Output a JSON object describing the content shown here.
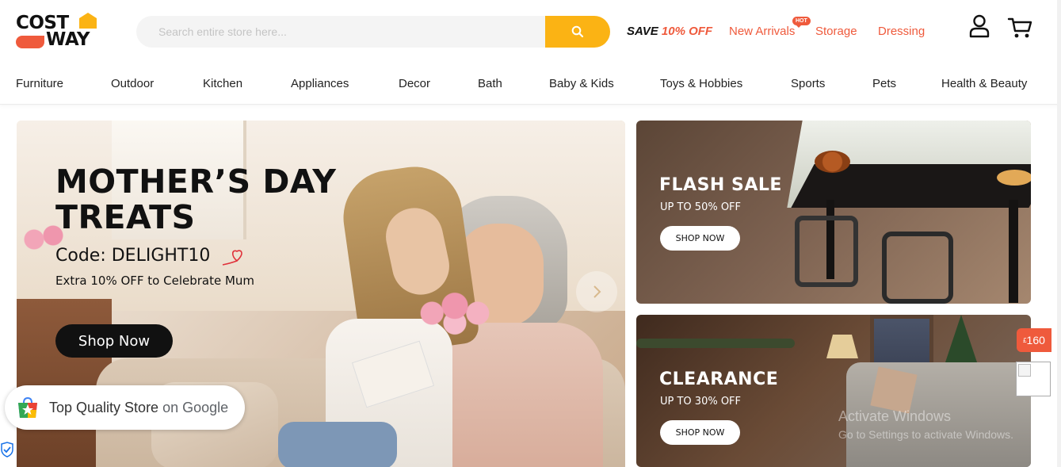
{
  "header": {
    "logo_line1": "COST",
    "logo_line2": "WAY",
    "search_placeholder": "Search entire store here...",
    "save_prefix": "SAVE",
    "save_value": "10% OFF",
    "links": {
      "new_arrivals": "New Arrivals",
      "hot_badge": "HOT",
      "storage": "Storage",
      "dressing": "Dressing"
    },
    "accent_color": "#ef5a3c",
    "brand_yellow": "#fbb314"
  },
  "categories": [
    "Furniture",
    "Outdoor",
    "Kitchen",
    "Appliances",
    "Decor",
    "Bath",
    "Baby & Kids",
    "Toys & Hobbies",
    "Sports",
    "Pets",
    "Health & Beauty"
  ],
  "hero": {
    "title_line1": "MOTHER’S DAY",
    "title_line2": "TREATS",
    "code": "Code: DELIGHT10",
    "subtitle": "Extra 10% OFF to Celebrate Mum",
    "button": "Shop Now"
  },
  "promos": [
    {
      "title": "FLASH SALE",
      "subtitle": "UP TO 50% OFF",
      "button": "SHOP NOW"
    },
    {
      "title": "CLEARANCE",
      "subtitle": "UP TO 30% OFF",
      "button": "SHOP NOW"
    }
  ],
  "google_badge": {
    "text_main": "Top Quality Store",
    "text_on": "on Google"
  },
  "coupon": {
    "currency": "£",
    "amount": "160"
  },
  "watermark": {
    "line1": "Activate Windows",
    "line2": "Go to Settings to activate Windows."
  }
}
